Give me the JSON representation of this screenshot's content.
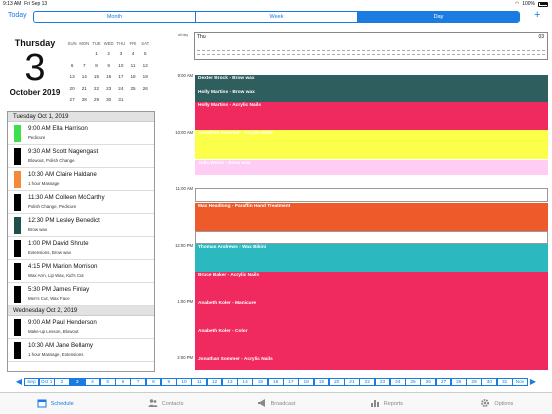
{
  "status": {
    "time": "9:13 AM",
    "date": "Fri Sep 13",
    "battery": "100%"
  },
  "toolbar": {
    "today": "Today",
    "views": [
      "Month",
      "Week",
      "Day"
    ],
    "selected_view": "Day",
    "add": "+"
  },
  "bigdate": {
    "weekday": "Thursday",
    "day": "3",
    "month_year": "October 2019"
  },
  "mini_cal": {
    "headers": [
      "SUN",
      "MON",
      "TUE",
      "WED",
      "THU",
      "FRI",
      "SAT"
    ],
    "weeks": [
      [
        "",
        "",
        "1",
        "2",
        "3",
        "4",
        "5"
      ],
      [
        "6",
        "7",
        "8",
        "9",
        "10",
        "11",
        "12"
      ],
      [
        "13",
        "14",
        "15",
        "16",
        "17",
        "18",
        "19"
      ],
      [
        "20",
        "21",
        "22",
        "23",
        "24",
        "25",
        "26"
      ],
      [
        "27",
        "28",
        "29",
        "30",
        "31",
        "",
        ""
      ]
    ]
  },
  "agenda": [
    {
      "header": "Tuesday Oct 1, 2019",
      "items": [
        {
          "time": "9:00 AM Ella Harrison",
          "service": "Pedicure",
          "color": "#3be04a"
        },
        {
          "time": "9:30 AM Scott Nagengast",
          "service": "Blowout, Polish Change",
          "color": "#000000"
        },
        {
          "time": "10:30 AM Claire Haldane",
          "service": "1 hour Massage",
          "color": "#f5893a"
        },
        {
          "time": "11:30 AM Colleen McCarthy",
          "service": "Polish Change, Pedicure",
          "color": "#000000"
        },
        {
          "time": "12:30 PM Lesley Benedict",
          "service": "Brow wax",
          "color": "#1d4f4c"
        },
        {
          "time": "1:00 PM David Shrute",
          "service": "Extensions, Brow wax",
          "color": "#000000"
        },
        {
          "time": "4:15 PM Marion Morrison",
          "service": "Wax Arm, Lip Wax, Kid's Cut",
          "color": "#000000"
        },
        {
          "time": "5:30 PM James Finlay",
          "service": "Men's Cut, Wax Face",
          "color": "#000000"
        }
      ]
    },
    {
      "header": "Wednesday Oct 2, 2019",
      "items": [
        {
          "time": "9:00 AM Paul Henderson",
          "service": "Make-up Lesson, Blowout",
          "color": "#000000"
        },
        {
          "time": "10:30 AM Jane Bellamy",
          "service": "1 hour Massage, Extensions",
          "color": "#000000"
        }
      ]
    }
  ],
  "day_view": {
    "allday_label": "all day",
    "day_label": "Thu",
    "day_num": "03",
    "hours": [
      "9:00 AM",
      "10:00 AM",
      "11:00 AM",
      "12:00 PM",
      "1:00 PM",
      "2:00 PM"
    ],
    "events": [
      {
        "label": "Dexter Brock - Brow wax",
        "color": "#2e5e5e"
      },
      {
        "label": "Holly Martins - Brow wax",
        "color": "#2e5e5e"
      },
      {
        "label": "Holly Martins - Acrylic Nails",
        "color": "#f0295e"
      },
      {
        "label": "Jonathan Sommer - Acrylic Nails",
        "color": "#fbff4a"
      },
      {
        "label": "",
        "color": "#fbff4a"
      },
      {
        "label": "Julia Weiss - Brow wax",
        "color": "#ffccf3"
      },
      {
        "label": "Max Headlong - Paraffin Hand Treatment",
        "color": "#ee5a2a"
      },
      {
        "label": "",
        "color": "#ee5a2a"
      },
      {
        "label": "Thomas Andrews - Wax Bikini",
        "color": "#2bb9bf"
      },
      {
        "label": "Bruce Baker - Acrylic Nails",
        "color": "#f0295e"
      },
      {
        "label": "Anabeth Koler - Manicure",
        "color": "#f0295e"
      },
      {
        "label": "Anabeth Koler - Color",
        "color": "#f0295e"
      },
      {
        "label": "Jonathan Sommer - Acrylic Nails",
        "color": "#f0295e"
      }
    ]
  },
  "date_strip": [
    "Sep",
    "Oct 1",
    "2",
    "3",
    "4",
    "5",
    "6",
    "7",
    "8",
    "9",
    "10",
    "11",
    "12",
    "13",
    "14",
    "15",
    "16",
    "17",
    "18",
    "19",
    "20",
    "21",
    "22",
    "23",
    "24",
    "25",
    "26",
    "27",
    "28",
    "29",
    "30",
    "31",
    "Nov"
  ],
  "date_strip_selected": "3",
  "tabs": [
    {
      "label": "Schedule",
      "icon": "calendar-icon",
      "selected": true
    },
    {
      "label": "Contacts",
      "icon": "people-icon"
    },
    {
      "label": "Broadcast",
      "icon": "megaphone-icon"
    },
    {
      "label": "Reports",
      "icon": "chart-icon"
    },
    {
      "label": "Options",
      "icon": "gear-icon"
    }
  ]
}
